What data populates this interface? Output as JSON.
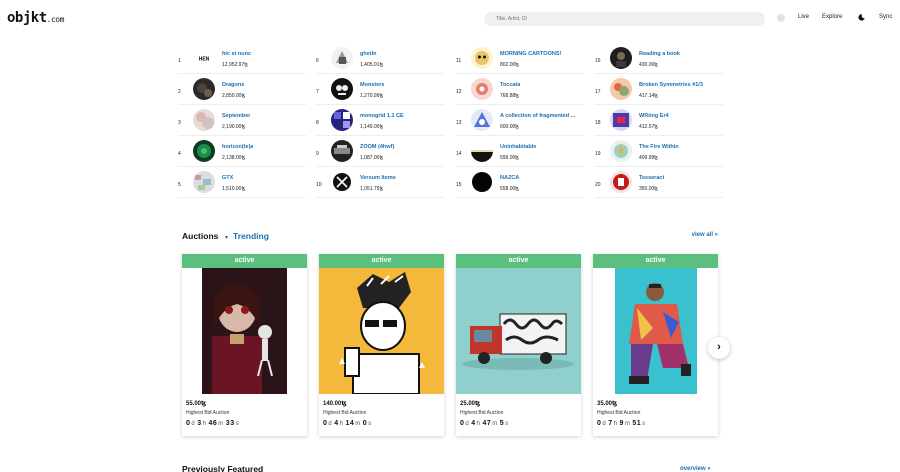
{
  "header": {
    "logo_main": "objkt",
    "logo_tld": ".com",
    "search_placeholder": "Title, Artist, ID",
    "nav_live": "Live",
    "nav_explore": "Explore",
    "nav_sync": "Sync"
  },
  "ranking": [
    {
      "rank": "1",
      "name": "hic et nunc",
      "value": "12,952.97ꜩ",
      "avatar": "hen-logo"
    },
    {
      "rank": "2",
      "name": "Dragons",
      "value": "2,850.00ꜩ",
      "avatar": "dark"
    },
    {
      "rank": "3",
      "name": "September",
      "value": "2,190.00ꜩ",
      "avatar": "pastel"
    },
    {
      "rank": "4",
      "name": "horizon(te)a",
      "value": "2,138.00ꜩ",
      "avatar": "green"
    },
    {
      "rank": "5",
      "name": "GTX",
      "value": "1,510.00ꜩ",
      "avatar": "noise"
    },
    {
      "rank": "6",
      "name": "ghetln",
      "value": "1,405.01ꜩ",
      "avatar": "grey-shapes"
    },
    {
      "rank": "7",
      "name": "Monsters",
      "value": "1,270.99ꜩ",
      "avatar": "monster"
    },
    {
      "rank": "8",
      "name": "monogrid 1.1 CE",
      "value": "1,149.00ꜩ",
      "avatar": "blue-grid"
    },
    {
      "rank": "9",
      "name": "ZOOM (4hwf)",
      "value": "1,087.00ꜩ",
      "avatar": "zoom"
    },
    {
      "rank": "10",
      "name": "Versum Items",
      "value": "1,051.75ꜩ",
      "avatar": "versum"
    },
    {
      "rank": "11",
      "name": "MORNING CARTOONS!",
      "value": "802.00ꜩ",
      "avatar": "cartoon"
    },
    {
      "rank": "12",
      "name": "Toccata",
      "value": "768.88ꜩ",
      "avatar": "toccata"
    },
    {
      "rank": "13",
      "name": "A collection of fragmented ...",
      "value": "600.00ꜩ",
      "avatar": "fragment"
    },
    {
      "rank": "14",
      "name": "Uninhabitable",
      "value": "599.00ꜩ",
      "avatar": "horizon"
    },
    {
      "rank": "15",
      "name": "NAZCA",
      "value": "558.00ꜩ",
      "avatar": "black-circle"
    },
    {
      "rank": "16",
      "name": "Reading a book",
      "value": "430.00ꜩ",
      "avatar": "dark-face"
    },
    {
      "rank": "17",
      "name": "Broken Symmetries #1/3",
      "value": "417.14ꜩ",
      "avatar": "colorful"
    },
    {
      "rank": "18",
      "name": "WRöng Er4",
      "value": "412.57ꜩ",
      "avatar": "wrong"
    },
    {
      "rank": "19",
      "name": "The Fire Within",
      "value": "409.99ꜩ",
      "avatar": "fire"
    },
    {
      "rank": "20",
      "name": "Tesseract",
      "value": "350.00ꜩ",
      "avatar": "red"
    }
  ],
  "auctions": {
    "title": "Auctions",
    "filter": "Trending",
    "view_all": "view all »",
    "cards": [
      {
        "status": "active",
        "price": "55.00ꜩ",
        "label": "Highest Bid Auction",
        "d": "0",
        "h": "3",
        "m": "46",
        "s": "33",
        "art": "gothic-doll"
      },
      {
        "status": "active",
        "price": "140.00ꜩ",
        "label": "Highest Bid Auction",
        "d": "0",
        "h": "4",
        "m": "14",
        "s": "0",
        "art": "cartoon-guy"
      },
      {
        "status": "active",
        "price": "25.00ꜩ",
        "label": "Highest Bid Auction",
        "d": "0",
        "h": "4",
        "m": "47",
        "s": "5",
        "art": "truck"
      },
      {
        "status": "active",
        "price": "35.00ꜩ",
        "label": "Highest Bid Auction",
        "d": "0",
        "h": "7",
        "m": "9",
        "s": "51",
        "art": "kneeling-man"
      }
    ],
    "units": {
      "d": "d",
      "h": "h",
      "m": "m",
      "s": "s"
    }
  },
  "previously_featured": {
    "title": "Previously Featured",
    "overview": "overview »"
  },
  "colors": {
    "accent": "#1a6fb0",
    "active": "#5bbf7e"
  }
}
